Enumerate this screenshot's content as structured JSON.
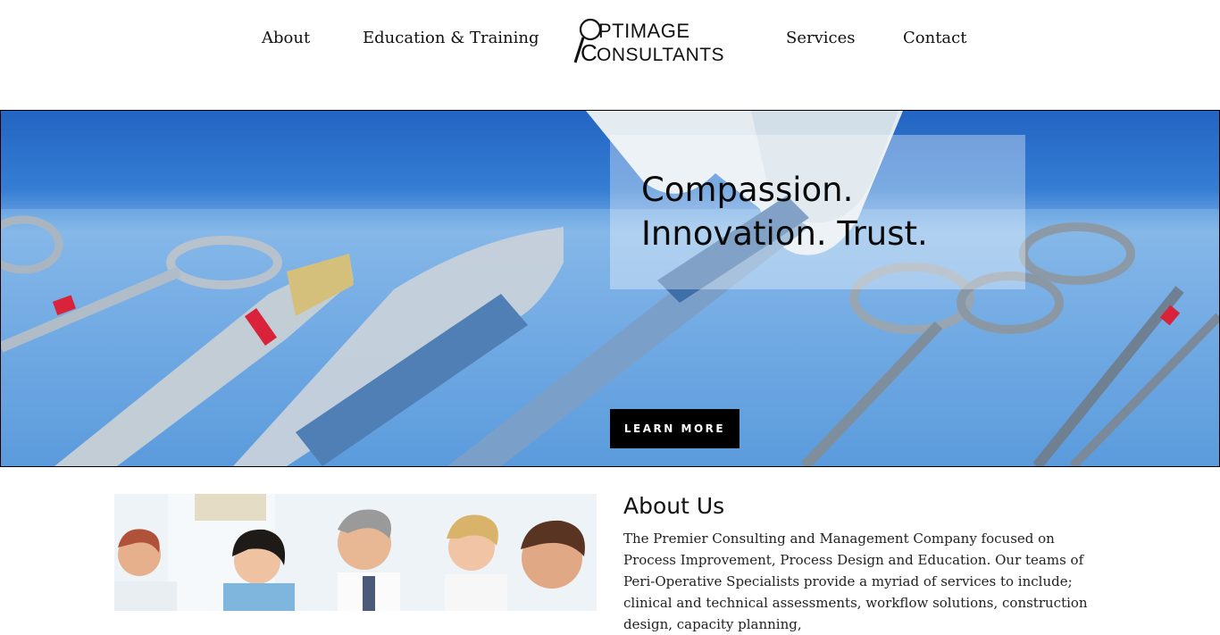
{
  "nav": {
    "items": [
      {
        "label": "About"
      },
      {
        "label": "Education & Training"
      },
      {
        "label": "Services"
      },
      {
        "label": "Contact"
      }
    ]
  },
  "logo": {
    "line1": "PTIMAGE",
    "line2": "ONSULTANTS"
  },
  "hero": {
    "title_line1": "Compassion.",
    "title_line2": "Innovation. Trust.",
    "button_label": "LEARN MORE"
  },
  "about": {
    "heading": "About Us",
    "body": "The Premier Consulting and Management Company focused on Process Improvement, Process Design and Education. Our teams of Peri-Operative Specialists provide a myriad of services to include; clinical and technical assessments, workflow solutions, construction design, capacity planning,"
  }
}
